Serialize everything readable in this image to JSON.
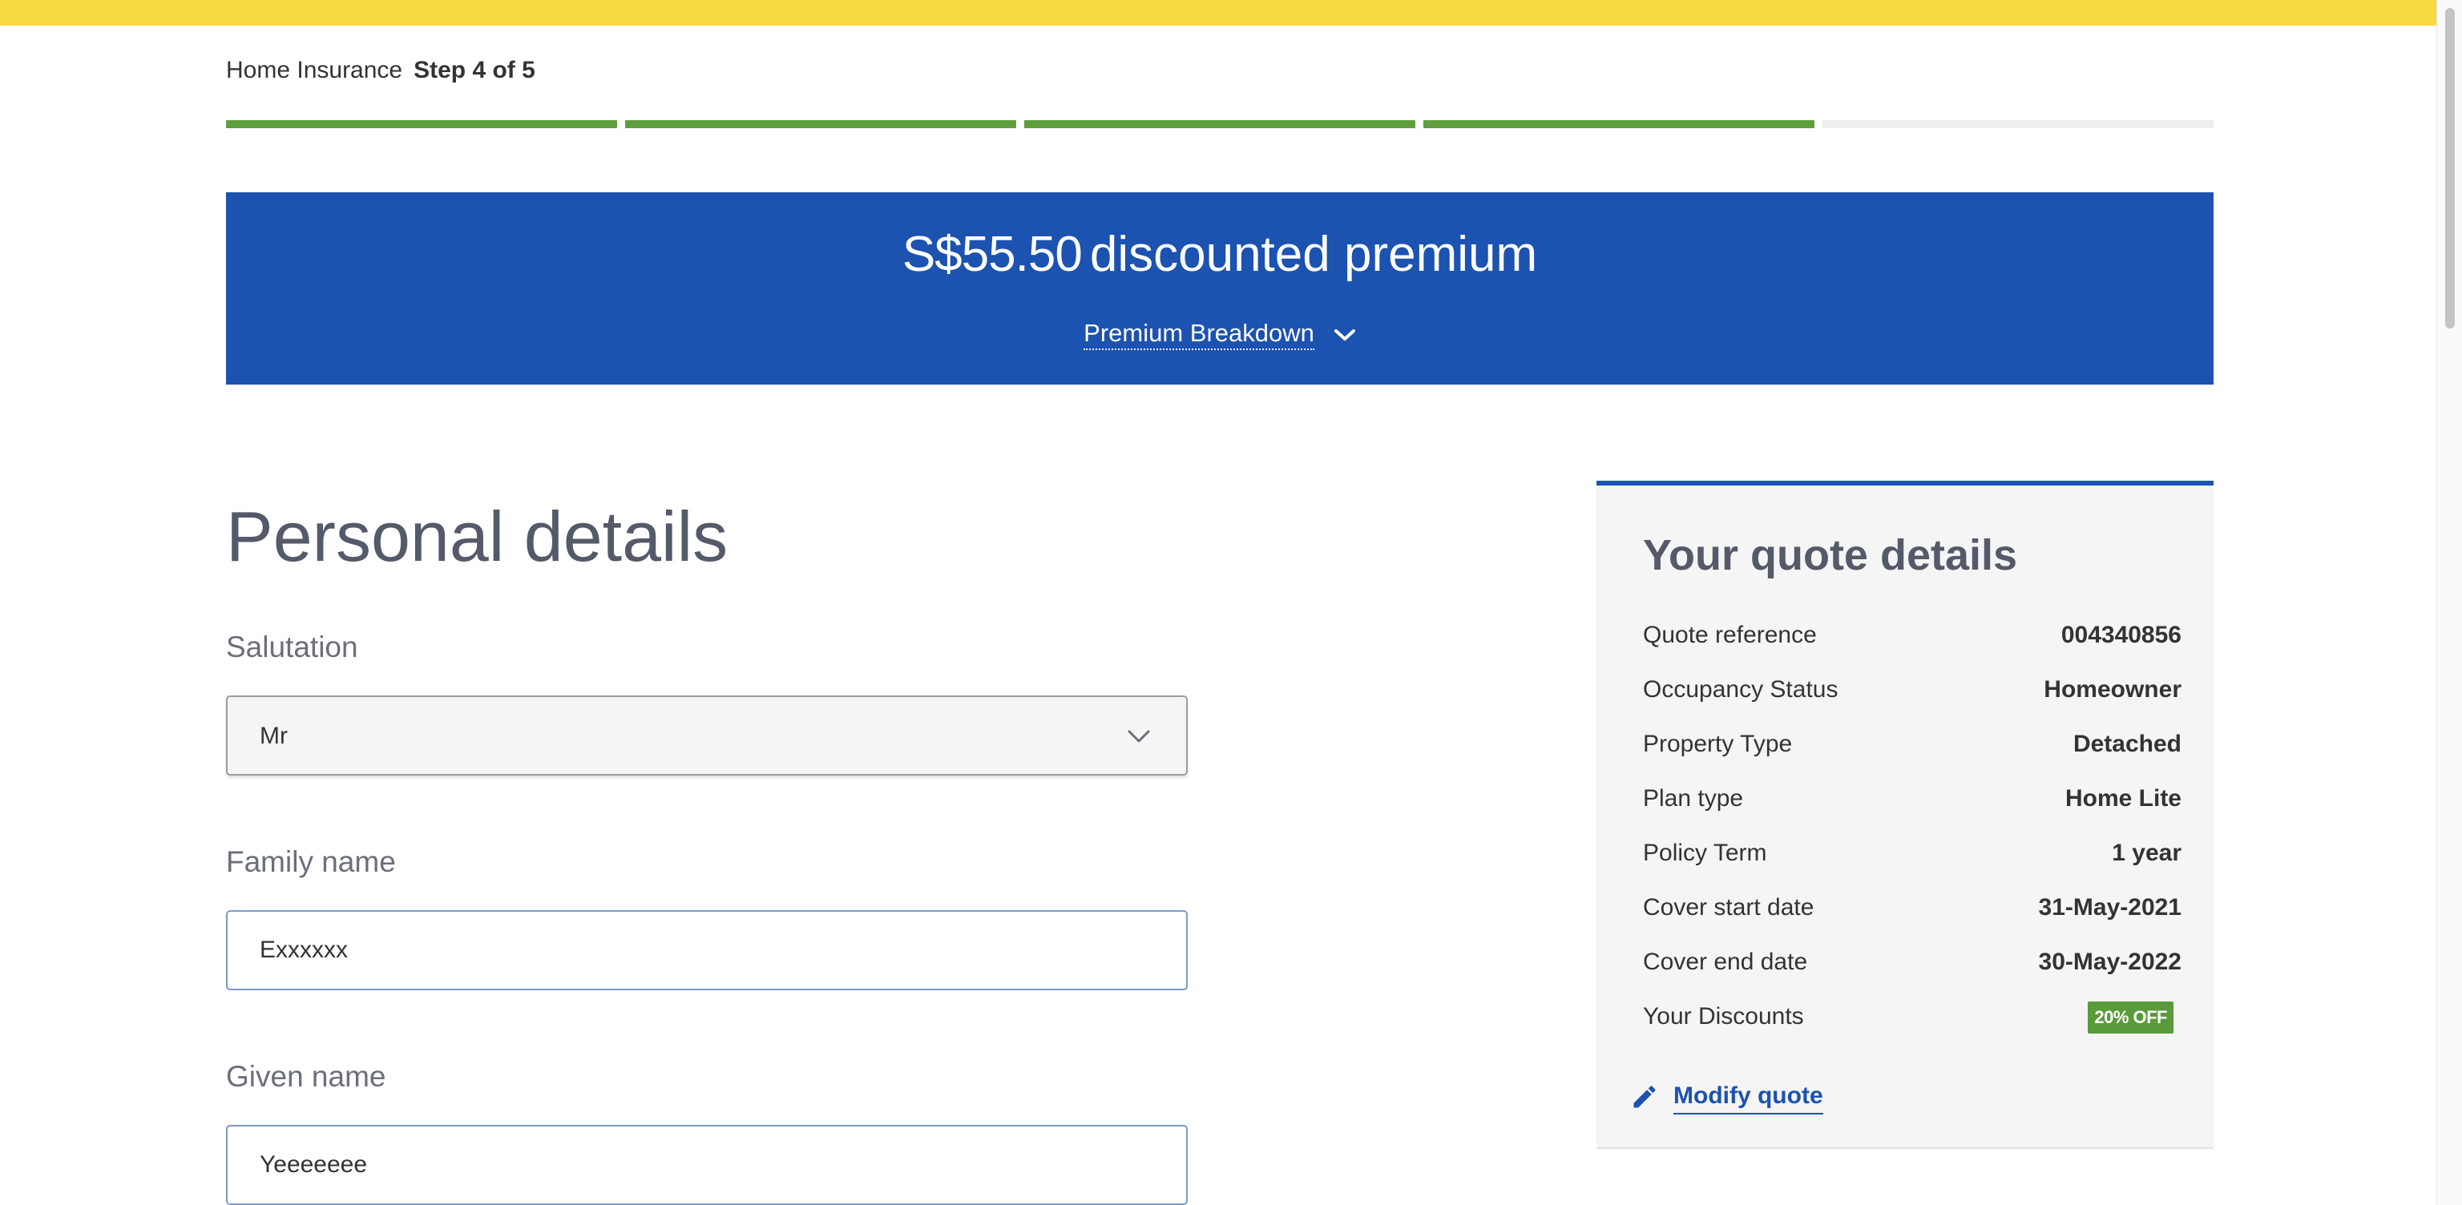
{
  "colors": {
    "top_stripe": "#f7d944",
    "primary_blue": "#1c52b0",
    "progress_complete": "#5f9e3c",
    "progress_pending": "#eeeeee",
    "discount_green": "#5a9a3a"
  },
  "header": {
    "product": "Home Insurance",
    "step": "Step 4 of 5"
  },
  "progress": {
    "total_steps": 5,
    "completed_steps": 4
  },
  "premium": {
    "amount": "S$55.50",
    "label": "discounted premium",
    "breakdown_link": "Premium Breakdown",
    "breakdown_icon": "chevron-down-icon"
  },
  "form": {
    "title": "Personal details",
    "salutation": {
      "label": "Salutation",
      "value": "Mr",
      "icon": "chevron-down-icon"
    },
    "family_name": {
      "label": "Family name",
      "value": "Exxxxxx"
    },
    "given_name": {
      "label": "Given name",
      "value": "Yeeeeeee"
    }
  },
  "quote": {
    "title": "Your quote details",
    "rows": [
      {
        "label": "Quote reference",
        "value": "004340856"
      },
      {
        "label": "Occupancy Status",
        "value": "Homeowner"
      },
      {
        "label": "Property Type",
        "value": "Detached"
      },
      {
        "label": "Plan type",
        "value": "Home Lite"
      },
      {
        "label": "Policy Term",
        "value": "1 year"
      },
      {
        "label": "Cover start date",
        "value": "31-May-2021"
      },
      {
        "label": "Cover end date",
        "value": "30-May-2022"
      }
    ],
    "discounts_label": "Your Discounts",
    "discount_badge": "20% OFF",
    "modify_label": "Modify quote",
    "modify_icon": "pencil-icon"
  }
}
